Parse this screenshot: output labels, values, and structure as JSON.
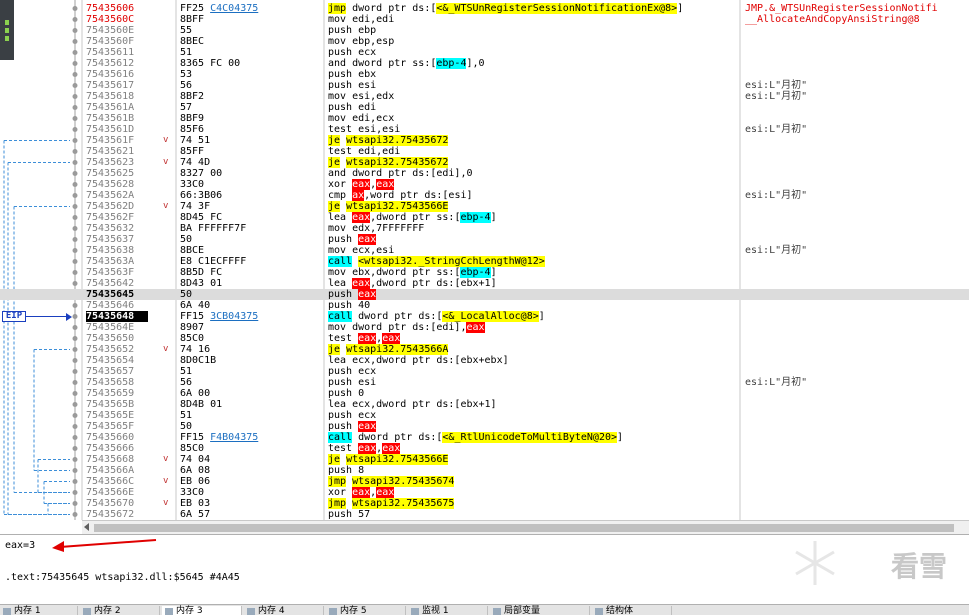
{
  "colors": {
    "eip_blue": "#1a3fbf",
    "selected_row": "#dcdcdc",
    "highlight_yellow": "#ffff00",
    "highlight_cyan": "#00ffff",
    "register_red": "#ff0000"
  },
  "rows": [
    {
      "addr": "75435606",
      "addr_style": "red",
      "arrow": "",
      "bytes": "FF25 C4C04375",
      "dis": "jmp dword ptr ds:[<&_WTSUnRegisterSessionNotificationEx@8>]",
      "comment": "JMP.&_WTSUnRegisterSessionNotifi",
      "comment_style": "red"
    },
    {
      "addr": "7543560C",
      "addr_style": "red",
      "arrow": "",
      "bytes": "8BFF",
      "dis": "mov edi,edi",
      "comment": "__AllocateAndCopyAnsiString@8",
      "comment_style": "red"
    },
    {
      "addr": "7543560E",
      "addr_style": "",
      "arrow": "",
      "bytes": "55",
      "dis": "push ebp",
      "comment": "",
      "comment_style": ""
    },
    {
      "addr": "7543560F",
      "addr_style": "",
      "arrow": "",
      "bytes": "8BEC",
      "dis": "mov ebp,esp",
      "comment": "",
      "comment_style": ""
    },
    {
      "addr": "75435611",
      "addr_style": "",
      "arrow": "",
      "bytes": "51",
      "dis": "push ecx",
      "comment": "",
      "comment_style": ""
    },
    {
      "addr": "75435612",
      "addr_style": "",
      "arrow": "",
      "bytes": "8365 FC 00",
      "dis": "and dword ptr ss:[ebp-4],0",
      "comment": "",
      "comment_style": ""
    },
    {
      "addr": "75435616",
      "addr_style": "",
      "arrow": "",
      "bytes": "53",
      "dis": "push ebx",
      "comment": "",
      "comment_style": ""
    },
    {
      "addr": "75435617",
      "addr_style": "",
      "arrow": "",
      "bytes": "56",
      "dis": "push esi",
      "comment": "esi:L\"月初\"",
      "comment_style": ""
    },
    {
      "addr": "75435618",
      "addr_style": "",
      "arrow": "",
      "bytes": "8BF2",
      "dis": "mov esi,edx",
      "comment": "esi:L\"月初\"",
      "comment_style": ""
    },
    {
      "addr": "7543561A",
      "addr_style": "",
      "arrow": "",
      "bytes": "57",
      "dis": "push edi",
      "comment": "",
      "comment_style": ""
    },
    {
      "addr": "7543561B",
      "addr_style": "",
      "arrow": "",
      "bytes": "8BF9",
      "dis": "mov edi,ecx",
      "comment": "",
      "comment_style": ""
    },
    {
      "addr": "7543561D",
      "addr_style": "",
      "arrow": "",
      "bytes": "85F6",
      "dis": "test esi,esi",
      "comment": "esi:L\"月初\"",
      "comment_style": ""
    },
    {
      "addr": "7543561F",
      "addr_style": "",
      "arrow": "v",
      "bytes": "74 51",
      "dis": "je wtsapi32.75435672",
      "comment": "",
      "comment_style": ""
    },
    {
      "addr": "75435621",
      "addr_style": "",
      "arrow": "",
      "bytes": "85FF",
      "dis": "test edi,edi",
      "comment": "",
      "comment_style": ""
    },
    {
      "addr": "75435623",
      "addr_style": "",
      "arrow": "v",
      "bytes": "74 4D",
      "dis": "je wtsapi32.75435672",
      "comment": "",
      "comment_style": ""
    },
    {
      "addr": "75435625",
      "addr_style": "",
      "arrow": "",
      "bytes": "8327 00",
      "dis": "and dword ptr ds:[edi],0",
      "comment": "",
      "comment_style": ""
    },
    {
      "addr": "75435628",
      "addr_style": "",
      "arrow": "",
      "bytes": "33C0",
      "dis": "xor eax,eax",
      "comment": "",
      "comment_style": ""
    },
    {
      "addr": "7543562A",
      "addr_style": "",
      "arrow": "",
      "bytes": "66:3B06",
      "dis": "cmp ax,word ptr ds:[esi]",
      "comment": "esi:L\"月初\"",
      "comment_style": ""
    },
    {
      "addr": "7543562D",
      "addr_style": "",
      "arrow": "v",
      "bytes": "74 3F",
      "dis": "je wtsapi32.7543566E",
      "comment": "",
      "comment_style": ""
    },
    {
      "addr": "7543562F",
      "addr_style": "",
      "arrow": "",
      "bytes": "8D45 FC",
      "dis": "lea eax,dword ptr ss:[ebp-4]",
      "comment": "",
      "comment_style": ""
    },
    {
      "addr": "75435632",
      "addr_style": "",
      "arrow": "",
      "bytes": "BA FFFFFF7F",
      "dis": "mov edx,7FFFFFFF",
      "comment": "",
      "comment_style": ""
    },
    {
      "addr": "75435637",
      "addr_style": "",
      "arrow": "",
      "bytes": "50",
      "dis": "push eax",
      "comment": "",
      "comment_style": ""
    },
    {
      "addr": "75435638",
      "addr_style": "",
      "arrow": "",
      "bytes": "8BCE",
      "dis": "mov ecx,esi",
      "comment": "esi:L\"月初\"",
      "comment_style": ""
    },
    {
      "addr": "7543563A",
      "addr_style": "",
      "arrow": "",
      "bytes": "E8 C1ECFFFF",
      "dis": "call <wtsapi32._StringCchLengthW@12>",
      "comment": "",
      "comment_style": ""
    },
    {
      "addr": "7543563F",
      "addr_style": "",
      "arrow": "",
      "bytes": "8B5D FC",
      "dis": "mov ebx,dword ptr ss:[ebp-4]",
      "comment": "",
      "comment_style": ""
    },
    {
      "addr": "75435642",
      "addr_style": "",
      "arrow": "",
      "bytes": "8D43 01",
      "dis": "lea eax,dword ptr ds:[ebx+1]",
      "comment": "",
      "comment_style": ""
    },
    {
      "addr": "75435645",
      "addr_style": "cur",
      "arrow": "",
      "bytes": "50",
      "dis": "push eax",
      "comment": "",
      "comment_style": "",
      "selected": true
    },
    {
      "addr": "75435646",
      "addr_style": "",
      "arrow": "",
      "bytes": "6A 40",
      "dis": "push 40",
      "comment": "",
      "comment_style": ""
    },
    {
      "addr": "75435648",
      "addr_style": "eip",
      "arrow": "",
      "bytes": "FF15 3CB04375",
      "dis": "call dword ptr ds:[<&_LocalAlloc@8>]",
      "comment": "",
      "comment_style": ""
    },
    {
      "addr": "7543564E",
      "addr_style": "",
      "arrow": "",
      "bytes": "8907",
      "dis": "mov dword ptr ds:[edi],eax",
      "comment": "",
      "comment_style": ""
    },
    {
      "addr": "75435650",
      "addr_style": "",
      "arrow": "",
      "bytes": "85C0",
      "dis": "test eax,eax",
      "comment": "",
      "comment_style": ""
    },
    {
      "addr": "75435652",
      "addr_style": "",
      "arrow": "v",
      "bytes": "74 16",
      "dis": "je wtsapi32.7543566A",
      "comment": "",
      "comment_style": ""
    },
    {
      "addr": "75435654",
      "addr_style": "",
      "arrow": "",
      "bytes": "8D0C1B",
      "dis": "lea ecx,dword ptr ds:[ebx+ebx]",
      "comment": "",
      "comment_style": ""
    },
    {
      "addr": "75435657",
      "addr_style": "",
      "arrow": "",
      "bytes": "51",
      "dis": "push ecx",
      "comment": "",
      "comment_style": ""
    },
    {
      "addr": "75435658",
      "addr_style": "",
      "arrow": "",
      "bytes": "56",
      "dis": "push esi",
      "comment": "esi:L\"月初\"",
      "comment_style": ""
    },
    {
      "addr": "75435659",
      "addr_style": "",
      "arrow": "",
      "bytes": "6A 00",
      "dis": "push 0",
      "comment": "",
      "comment_style": ""
    },
    {
      "addr": "7543565B",
      "addr_style": "",
      "arrow": "",
      "bytes": "8D4B 01",
      "dis": "lea ecx,dword ptr ds:[ebx+1]",
      "comment": "",
      "comment_style": ""
    },
    {
      "addr": "7543565E",
      "addr_style": "",
      "arrow": "",
      "bytes": "51",
      "dis": "push ecx",
      "comment": "",
      "comment_style": ""
    },
    {
      "addr": "7543565F",
      "addr_style": "",
      "arrow": "",
      "bytes": "50",
      "dis": "push eax",
      "comment": "",
      "comment_style": ""
    },
    {
      "addr": "75435660",
      "addr_style": "",
      "arrow": "",
      "bytes": "FF15 F4B04375",
      "dis": "call dword ptr ds:[<&_RtlUnicodeToMultiByteN@20>]",
      "comment": "",
      "comment_style": ""
    },
    {
      "addr": "75435666",
      "addr_style": "",
      "arrow": "",
      "bytes": "85C0",
      "dis": "test eax,eax",
      "comment": "",
      "comment_style": ""
    },
    {
      "addr": "75435668",
      "addr_style": "",
      "arrow": "v",
      "bytes": "74 04",
      "dis": "je wtsapi32.7543566E",
      "comment": "",
      "comment_style": ""
    },
    {
      "addr": "7543566A",
      "addr_style": "",
      "arrow": "",
      "bytes": "6A 08",
      "dis": "push 8",
      "comment": "",
      "comment_style": ""
    },
    {
      "addr": "7543566C",
      "addr_style": "",
      "arrow": "v",
      "bytes": "EB 06",
      "dis": "jmp wtsapi32.75435674",
      "comment": "",
      "comment_style": ""
    },
    {
      "addr": "7543566E",
      "addr_style": "",
      "arrow": "",
      "bytes": "33C0",
      "dis": "xor eax,eax",
      "comment": "",
      "comment_style": ""
    },
    {
      "addr": "75435670",
      "addr_style": "",
      "arrow": "v",
      "bytes": "EB 03",
      "dis": "jmp wtsapi32.75435675",
      "comment": "",
      "comment_style": ""
    },
    {
      "addr": "75435672",
      "addr_style": "",
      "arrow": "",
      "bytes": "6A 57",
      "dis": "push 57",
      "comment": "",
      "comment_style": ""
    }
  ],
  "eip_label": "EIP",
  "info": {
    "register_line": "eax=3",
    "location_line": ".text:75435645 wtsapi32.dll:$5645 #4A45"
  },
  "watermark_text": "看雪",
  "tabs": [
    {
      "label": "内存 1",
      "active": false
    },
    {
      "label": "内存 2",
      "active": false
    },
    {
      "label": "内存 3",
      "active": true
    },
    {
      "label": "内存 4",
      "active": false
    },
    {
      "label": "内存 5",
      "active": false
    },
    {
      "label": "监视 1",
      "active": false
    },
    {
      "label": "局部变量",
      "active": false
    },
    {
      "label": "结构体",
      "active": false
    }
  ]
}
